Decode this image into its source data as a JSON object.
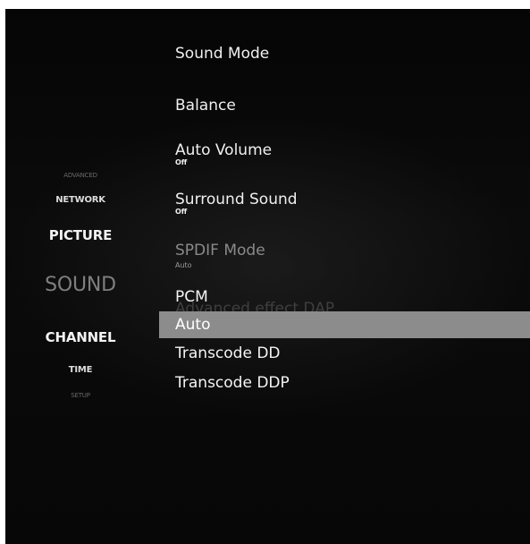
{
  "nav": {
    "advanced": "ADVANCED",
    "network": "NETWORK",
    "picture": "PICTURE",
    "sound": "SOUND",
    "channel": "CHANNEL",
    "time": "TIME",
    "setup": "SETUP"
  },
  "menu": {
    "sound_mode": "Sound Mode",
    "balance": "Balance",
    "auto_volume": {
      "label": "Auto Volume",
      "value": "Off"
    },
    "surround_sound": {
      "label": "Surround Sound",
      "value": "Off"
    },
    "spdif_mode": {
      "label": "SPDIF Mode",
      "value": "Auto"
    },
    "advanced_effect_dap": "Advanced effect DAP"
  },
  "dropdown": {
    "options": [
      "PCM",
      "Auto",
      "Transcode DD",
      "Transcode DDP"
    ],
    "selected": "Auto"
  },
  "colors": {
    "background": "#070707",
    "highlight": "#8c8c8c",
    "text": "#f0f0f0",
    "dimmed_text": "#8a8a8a"
  }
}
